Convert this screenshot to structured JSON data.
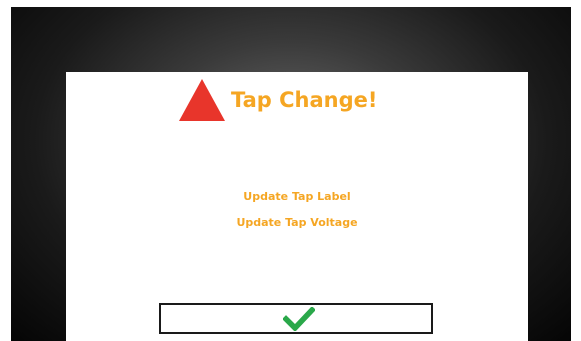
{
  "dialog": {
    "title": "Tap Change!",
    "icon": "warning-triangle-icon",
    "links": [
      {
        "label": "Update Tap Label"
      },
      {
        "label": "Update Tap Voltage"
      }
    ],
    "confirm": {
      "icon": "checkmark-icon"
    }
  },
  "colors": {
    "accent": "#f5a623",
    "warning": "#e8352b",
    "confirm": "#2aa84a"
  }
}
